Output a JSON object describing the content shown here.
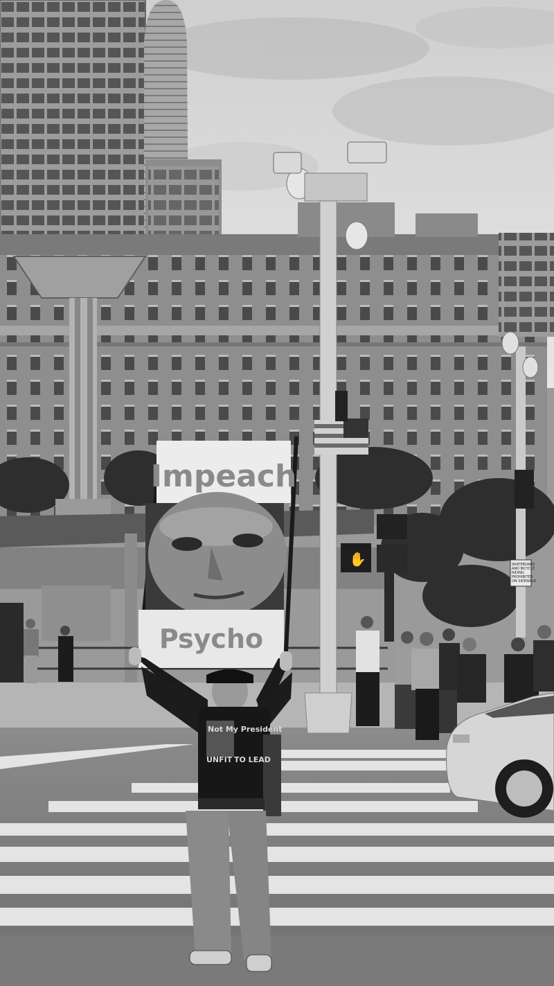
{
  "photo": {
    "style": "black-and-white street photograph",
    "colors": {
      "sky": "#d9d9d9",
      "building": "#8c8c8c",
      "road": "#7e7e7e",
      "stripe": "#e4e4e4",
      "sign_paper": "#ececec",
      "sign_text": "#8a8a8a"
    }
  },
  "protest_sign": {
    "top_text": "Impeach",
    "bottom_text": "Psycho"
  },
  "shirt": {
    "line1": "Not My President",
    "line2": "UNFIT",
    "line3": "TO LEAD"
  },
  "street_sign": {
    "line1": "SKATEBOARD",
    "line2": "AND BICYCLE",
    "line3": "RIDING",
    "line4": "PROHIBITED",
    "line5": "ON SIDEWALK"
  }
}
